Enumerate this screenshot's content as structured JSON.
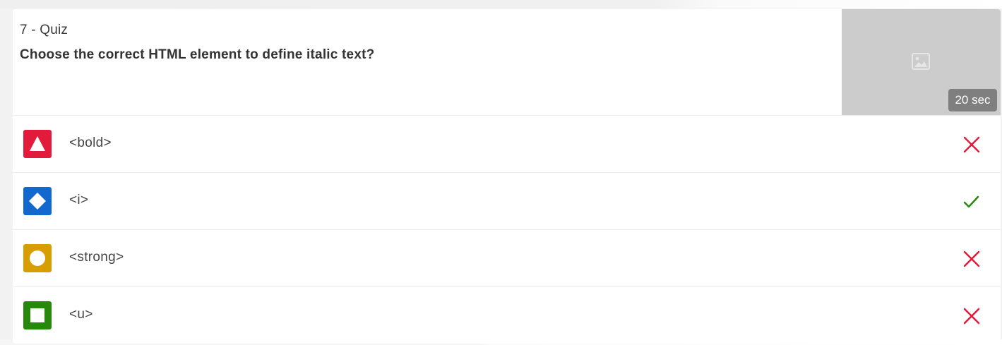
{
  "quiz": {
    "label": "7 - Quiz",
    "question": "Choose the correct HTML element to define italic text?",
    "timer": "20 sec"
  },
  "answers": [
    {
      "text": "<bold>",
      "shape": "triangle",
      "color": "#e21b3c",
      "correct": false
    },
    {
      "text": "<i>",
      "shape": "diamond",
      "color": "#1368ce",
      "correct": true
    },
    {
      "text": "<strong>",
      "shape": "circle",
      "color": "#d89e00",
      "correct": false
    },
    {
      "text": "<u>",
      "shape": "square",
      "color": "#26890c",
      "correct": false
    }
  ],
  "colors": {
    "incorrect": "#e21b3c",
    "correct": "#26890c",
    "media_placeholder": "#cccccc",
    "timer_badge": "#7f7f7f"
  }
}
